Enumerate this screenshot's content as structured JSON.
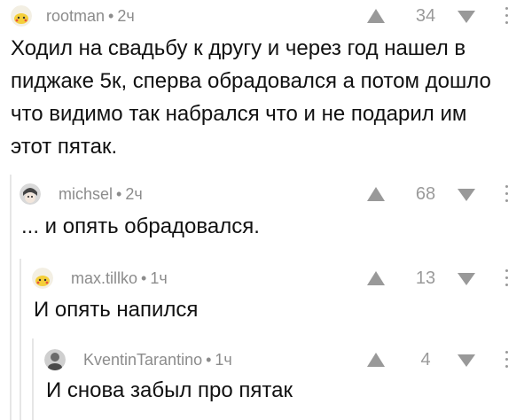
{
  "comments": [
    {
      "username": "rootman",
      "separator": "•",
      "time": "2ч",
      "score": "34",
      "text_lines": [
        "Ходил на свадьбу к другу и через год нашел в",
        "пиджаке 5к, сперва обрадовался а потом дошло",
        "что видимо так набрался что и не подарил им",
        "этот пятак."
      ]
    },
    {
      "username": "michsel",
      "separator": "•",
      "time": "2ч",
      "score": "68",
      "text_lines": [
        "... и опять обрадовался."
      ]
    },
    {
      "username": "max.tillko",
      "separator": "•",
      "time": "1ч",
      "score": "13",
      "text_lines": [
        "И опять напился"
      ]
    },
    {
      "username": "KventinTarantino",
      "separator": "•",
      "time": "1ч",
      "score": "4",
      "text_lines": [
        "И снова забыл про пятак"
      ]
    }
  ],
  "icons": {
    "avatar_1": "pikachu-avatar-icon",
    "avatar_2": "anime-avatar-icon",
    "avatar_3": "pikachu-avatar-icon",
    "avatar_4": "photo-avatar-icon",
    "upvote": "up-arrow-icon",
    "downvote": "down-arrow-icon",
    "menu": "more-vertical-icon"
  },
  "colors": {
    "meta_text": "#8c8c8c",
    "vote_icon": "#999999",
    "thread_line": "#e6e6e6",
    "body_text": "#111111"
  }
}
